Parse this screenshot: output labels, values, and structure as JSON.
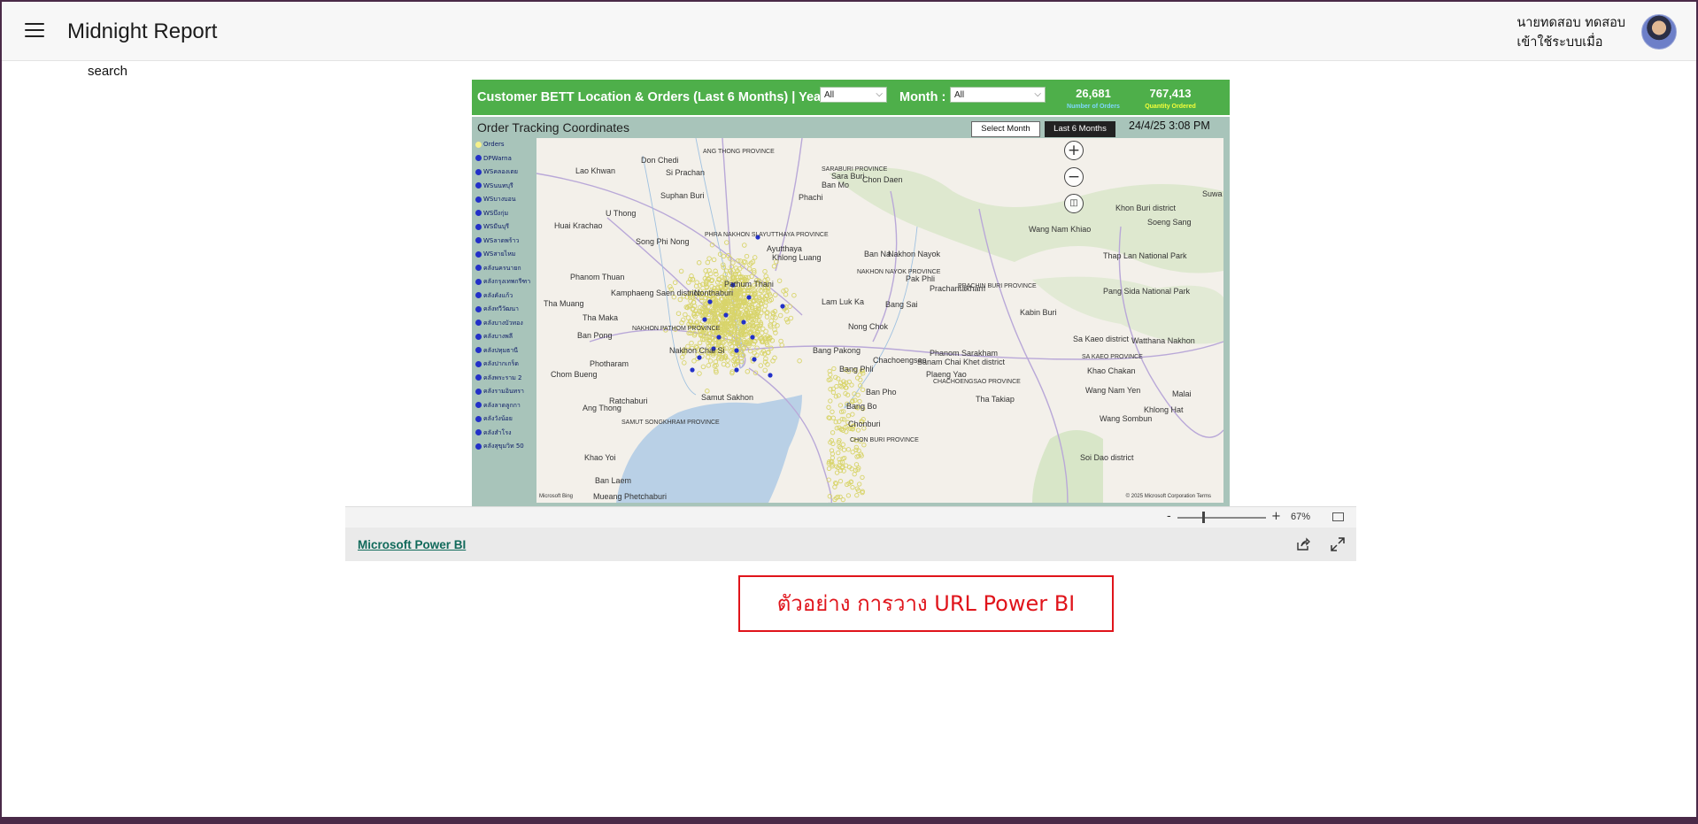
{
  "app": {
    "title": "Midnight Report",
    "menu_icon": "hamburger-menu-icon"
  },
  "user": {
    "name": "นายทดสอบ ทดสอบ",
    "status": "เข้าใช้ระบบเมื่อ",
    "avatar_icon": "user-avatar"
  },
  "search": {
    "label": "search"
  },
  "report": {
    "title": "Customer BETT Location & Orders (Last 6 Months) | Year :",
    "year_select": "All",
    "month_label": "Month :",
    "month_select": "All",
    "kpis": [
      {
        "value": "26,681",
        "label": "Number of Orders",
        "color": "#7fd8ff"
      },
      {
        "value": "767,413",
        "label": "Quantity Ordered",
        "color": "#f4ff3a"
      }
    ],
    "map_title": "Order Tracking Coordinates",
    "btn_select_month": "Select Month",
    "btn_last_6_months": "Last 6 Months",
    "timestamp": "24/4/25 3:08 PM",
    "legend": [
      {
        "label": "Orders",
        "color": "#f5f08a"
      },
      {
        "label": "DPWarna",
        "color": "#2230c8"
      },
      {
        "label": "WSคลองเตย",
        "color": "#2230c8"
      },
      {
        "label": "WSนนทบุรี",
        "color": "#2230c8"
      },
      {
        "label": "WSบางบอน",
        "color": "#2230c8"
      },
      {
        "label": "WSบึงกุ่ม",
        "color": "#2230c8"
      },
      {
        "label": "WSมีนบุรี",
        "color": "#2230c8"
      },
      {
        "label": "WSลาดพร้าว",
        "color": "#2230c8"
      },
      {
        "label": "WSสายไหม",
        "color": "#2230c8"
      },
      {
        "label": "คลังนครนายก",
        "color": "#2230c8"
      },
      {
        "label": "คลังกรุงเทพกรีฑา",
        "color": "#2230c8"
      },
      {
        "label": "คลังคังแก้ว",
        "color": "#2230c8"
      },
      {
        "label": "คลังทวีวัฒนา",
        "color": "#2230c8"
      },
      {
        "label": "คลังบางบัวทอง",
        "color": "#2230c8"
      },
      {
        "label": "คลังบางพลี",
        "color": "#2230c8"
      },
      {
        "label": "คลังปทุมธานี",
        "color": "#2230c8"
      },
      {
        "label": "คลังปากเกร็ด",
        "color": "#2230c8"
      },
      {
        "label": "คลังพระราม 2",
        "color": "#2230c8"
      },
      {
        "label": "คลังรามอินทรา",
        "color": "#2230c8"
      },
      {
        "label": "คลังลาดลูกกา",
        "color": "#2230c8"
      },
      {
        "label": "คลังวังน้อย",
        "color": "#2230c8"
      },
      {
        "label": "คลังสำโรง",
        "color": "#2230c8"
      },
      {
        "label": "คลังสุขุมวิท 50",
        "color": "#2230c8"
      }
    ],
    "map_labels": [
      "Don Chedi",
      "Sara Buri",
      "Phachi",
      "U Thong",
      "Song Phi Nong",
      "Khlong Luang",
      "Kamphaeng Saen district",
      "NAKHON PATHOM PROVINCE",
      "Nakhon Chai Si",
      "Photharam",
      "Ratchaburi",
      "Chom Bueng",
      "Ban Pong",
      "Tha Maka",
      "Tha Muang",
      "Phanom Thuan",
      "Lao Khwan",
      "Huai Krachao",
      "Samut Sakhon",
      "Nong Chok",
      "Bang Pakong",
      "Chachoengsao",
      "Sanam Chai Khet district",
      "CHACHOENGSAO PROVINCE",
      "Tha Takiap",
      "Wang Nam Yen",
      "Khlong Hat",
      "Wang Sombun",
      "Sa Kaeo district",
      "SA KAEO PROVINCE",
      "Watthana Nakhon",
      "Khao Chakan",
      "Soi Dao district",
      "Chonburi",
      "CHON BURI PROVINCE",
      "Kabin Buri",
      "PRACHIN BURI PROVINCE",
      "Prachantakham",
      "Wang Nam Khiao",
      "Khon Buri district",
      "Soeng Sang",
      "Ban Na",
      "Nakhon Nayok",
      "NAKHON NAYOK PROVINCE",
      "Pak Phli",
      "Bang Sai",
      "Ban Mo",
      "Chon Daen",
      "ANG THONG PROVINCE",
      "Si Prachan",
      "Suphan Buri",
      "PHRA NAKHON SI AYUTTHAYA PROVINCE",
      "Ayutthaya",
      "SARABURI PROVINCE",
      "Phanom Sarakham",
      "Plaeng Yao",
      "Ban Pho",
      "Ban Laem",
      "Mueang Phetchaburi",
      "Khao Yoi",
      "Ang Thong",
      "SAMUT SONGKHRAM PROVINCE",
      "Bang Bo",
      "Bang Phli",
      "Thap Lan National Park",
      "Pang Sida National Park",
      "Malai",
      "Suwa",
      "Pathum Thani",
      "Nonthaburi",
      "Lam Luk Ka"
    ],
    "map_attribution": "Microsoft Bing",
    "map_copyright": "© 2025 Microsoft Corporation  Terms"
  },
  "viewer": {
    "zoom_minus": "-",
    "zoom_plus": "+",
    "zoom_percent": "67%",
    "zoom_level": 0.67,
    "brand_link": "Microsoft Power BI",
    "share_icon": "share-icon",
    "expand_icon": "fullscreen-icon"
  },
  "note": {
    "text": "ตัวอย่าง การวาง URL Power BI",
    "color": "#e0141b"
  },
  "colors": {
    "header_green": "#4eaf4a",
    "map_panel": "#a8c4ba",
    "order_dot": "#d8d46a",
    "warehouse_dot": "#2230c8"
  }
}
